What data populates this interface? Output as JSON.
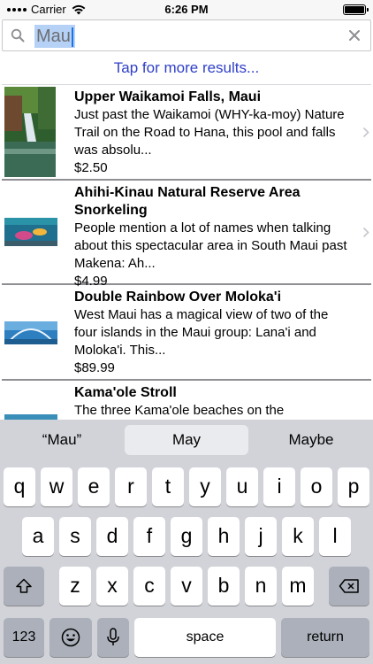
{
  "status_bar": {
    "carrier": "Carrier",
    "time": "6:26 PM"
  },
  "search": {
    "value": "Mau",
    "more_results": "Tap for more results..."
  },
  "results": [
    {
      "title": "Upper Waikamoi Falls, Maui",
      "description": "Just past the Waikamoi (WHY-ka-moy) Nature Trail on the Road to Hana, this pool and falls was absolu...",
      "price": "$2.50"
    },
    {
      "title": "Ahihi-Kinau Natural Reserve Area Snorkeling",
      "description": "People mention a lot of names when talking about this spectacular area in South Maui past Makena: Ah...",
      "price": "$4.99"
    },
    {
      "title": "Double Rainbow Over Moloka'i",
      "description": "West Maui has a magical view of two of the four islands in the Maui group: Lana'i and Moloka'i. This...",
      "price": "$89.99"
    },
    {
      "title": "Kama'ole Stroll",
      "description": "The three Kama'ole beaches on the"
    }
  ],
  "keyboard": {
    "suggestions": [
      "“Mau”",
      "May",
      "Maybe"
    ],
    "row1": [
      "q",
      "w",
      "e",
      "r",
      "t",
      "y",
      "u",
      "i",
      "o",
      "p"
    ],
    "row2": [
      "a",
      "s",
      "d",
      "f",
      "g",
      "h",
      "j",
      "k",
      "l"
    ],
    "row3": [
      "z",
      "x",
      "c",
      "v",
      "b",
      "n",
      "m"
    ],
    "numbers_label": "123",
    "space_label": "space",
    "return_label": "return"
  }
}
